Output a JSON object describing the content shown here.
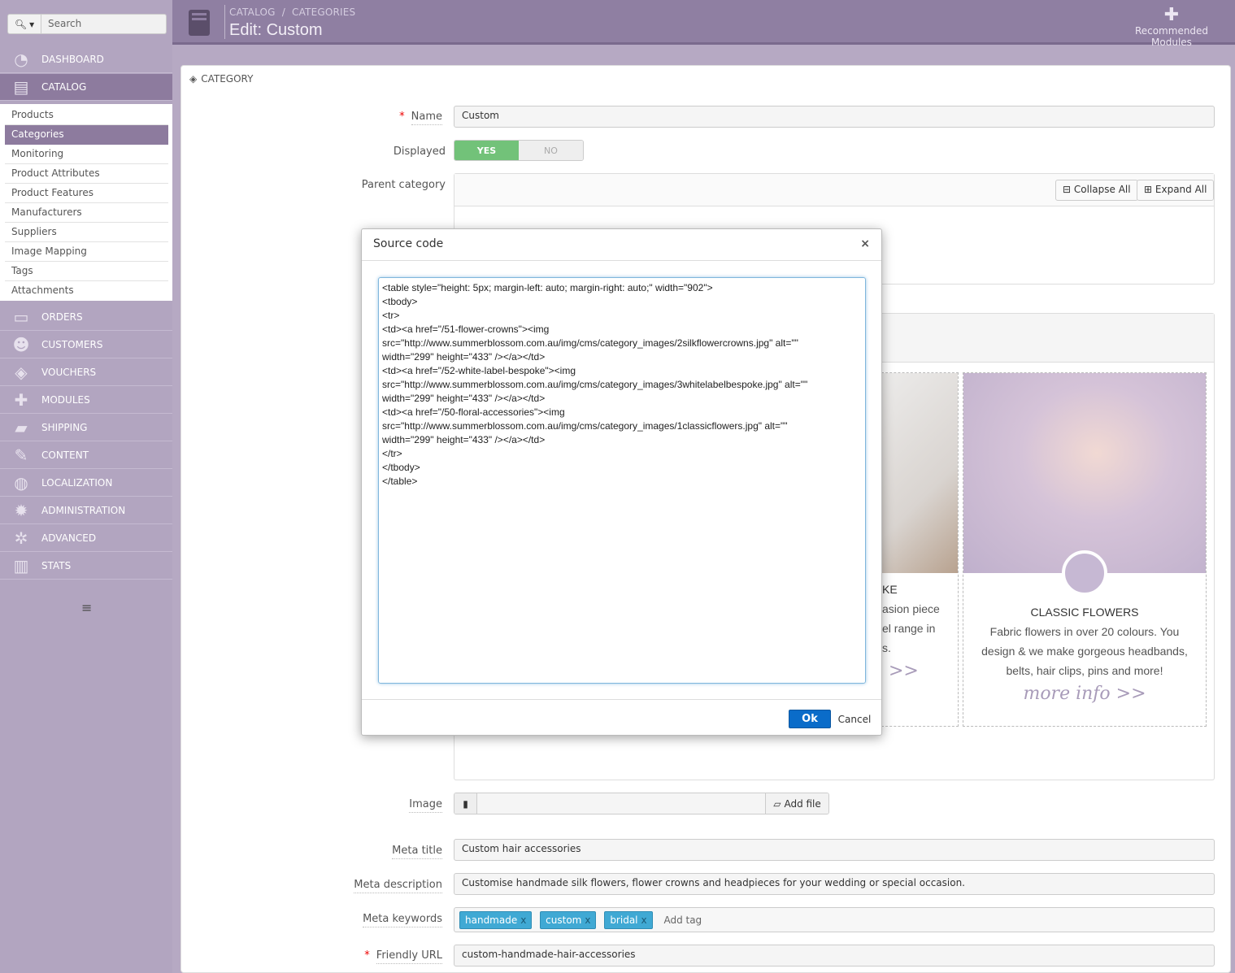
{
  "search": {
    "placeholder": "Search"
  },
  "sidebar": {
    "items": [
      {
        "label": "DASHBOARD",
        "icon": "dashboard-icon"
      },
      {
        "label": "CATALOG",
        "icon": "book-icon"
      },
      {
        "label": "ORDERS",
        "icon": "credit-card-icon"
      },
      {
        "label": "CUSTOMERS",
        "icon": "users-icon"
      },
      {
        "label": "VOUCHERS",
        "icon": "tags-icon"
      },
      {
        "label": "MODULES",
        "icon": "puzzle-icon"
      },
      {
        "label": "SHIPPING",
        "icon": "truck-icon"
      },
      {
        "label": "CONTENT",
        "icon": "wrench-icon"
      },
      {
        "label": "LOCALIZATION",
        "icon": "globe-icon"
      },
      {
        "label": "ADMINISTRATION",
        "icon": "cog-icon"
      },
      {
        "label": "ADVANCED",
        "icon": "cogs-icon"
      },
      {
        "label": "STATS",
        "icon": "bar-chart-icon"
      }
    ],
    "catalog_sub": [
      "Products",
      "Categories",
      "Monitoring",
      "Product Attributes",
      "Product Features",
      "Manufacturers",
      "Suppliers",
      "Image Mapping",
      "Tags",
      "Attachments"
    ]
  },
  "header": {
    "breadcrumb_1": "CATALOG",
    "breadcrumb_sep": "/",
    "breadcrumb_2": "CATEGORIES",
    "title": "Edit: Custom",
    "recommended": "Recommended Modules"
  },
  "panel": {
    "heading": "CATEGORY",
    "name_label": "Name",
    "name_value": "Custom",
    "displayed_label": "Displayed",
    "yes": "YES",
    "no": "NO",
    "parent_label": "Parent category",
    "collapse_all": "Collapse All",
    "expand_all": "Expand All",
    "image_label": "Image",
    "add_file": "Add file",
    "meta_title_label": "Meta title",
    "meta_title_value": "Custom hair accessories",
    "meta_desc_label": "Meta description",
    "meta_desc_value": "Customise handmade silk flowers, flower crowns and headpieces for your wedding or special occasion.",
    "meta_keywords_label": "Meta keywords",
    "tags": [
      "handmade",
      "custom",
      "bridal"
    ],
    "tag_remove": "x",
    "add_tag": "Add tag",
    "friendly_url_label": "Friendly URL",
    "friendly_url_value": "custom-handmade-hair-accessories"
  },
  "preview": {
    "left_title": "KE",
    "left_line1": "asion piece",
    "left_line2": "el range in",
    "left_line3": "s.",
    "left_more": ">>",
    "right_title": "CLASSIC FLOWERS",
    "right_line1": "Fabric flowers in over 20 colours. You",
    "right_line2": "design & we make gorgeous headbands,",
    "right_line3": "belts, hair clips, pins and more!",
    "right_more": "more info >>"
  },
  "modal": {
    "title": "Source code",
    "close": "×",
    "code": "<table style=\"height: 5px; margin-left: auto; margin-right: auto;\" width=\"902\">\n<tbody>\n<tr>\n<td><a href=\"/51-flower-crowns\"><img\nsrc=\"http://www.summerblossom.com.au/img/cms/category_images/2silkflowercrowns.jpg\" alt=\"\"\nwidth=\"299\" height=\"433\" /></a></td>\n<td><a href=\"/52-white-label-bespoke\"><img\nsrc=\"http://www.summerblossom.com.au/img/cms/category_images/3whitelabelbespoke.jpg\" alt=\"\"\nwidth=\"299\" height=\"433\" /></a></td>\n<td><a href=\"/50-floral-accessories\"><img\nsrc=\"http://www.summerblossom.com.au/img/cms/category_images/1classicflowers.jpg\" alt=\"\"\nwidth=\"299\" height=\"433\" /></a></td>\n</tr>\n</tbody>\n</table>",
    "ok": "Ok",
    "cancel": "Cancel"
  },
  "colors": {
    "accent": "#8d7b9e",
    "ok_button": "#0a6cc9",
    "switch_yes": "#72c279"
  }
}
